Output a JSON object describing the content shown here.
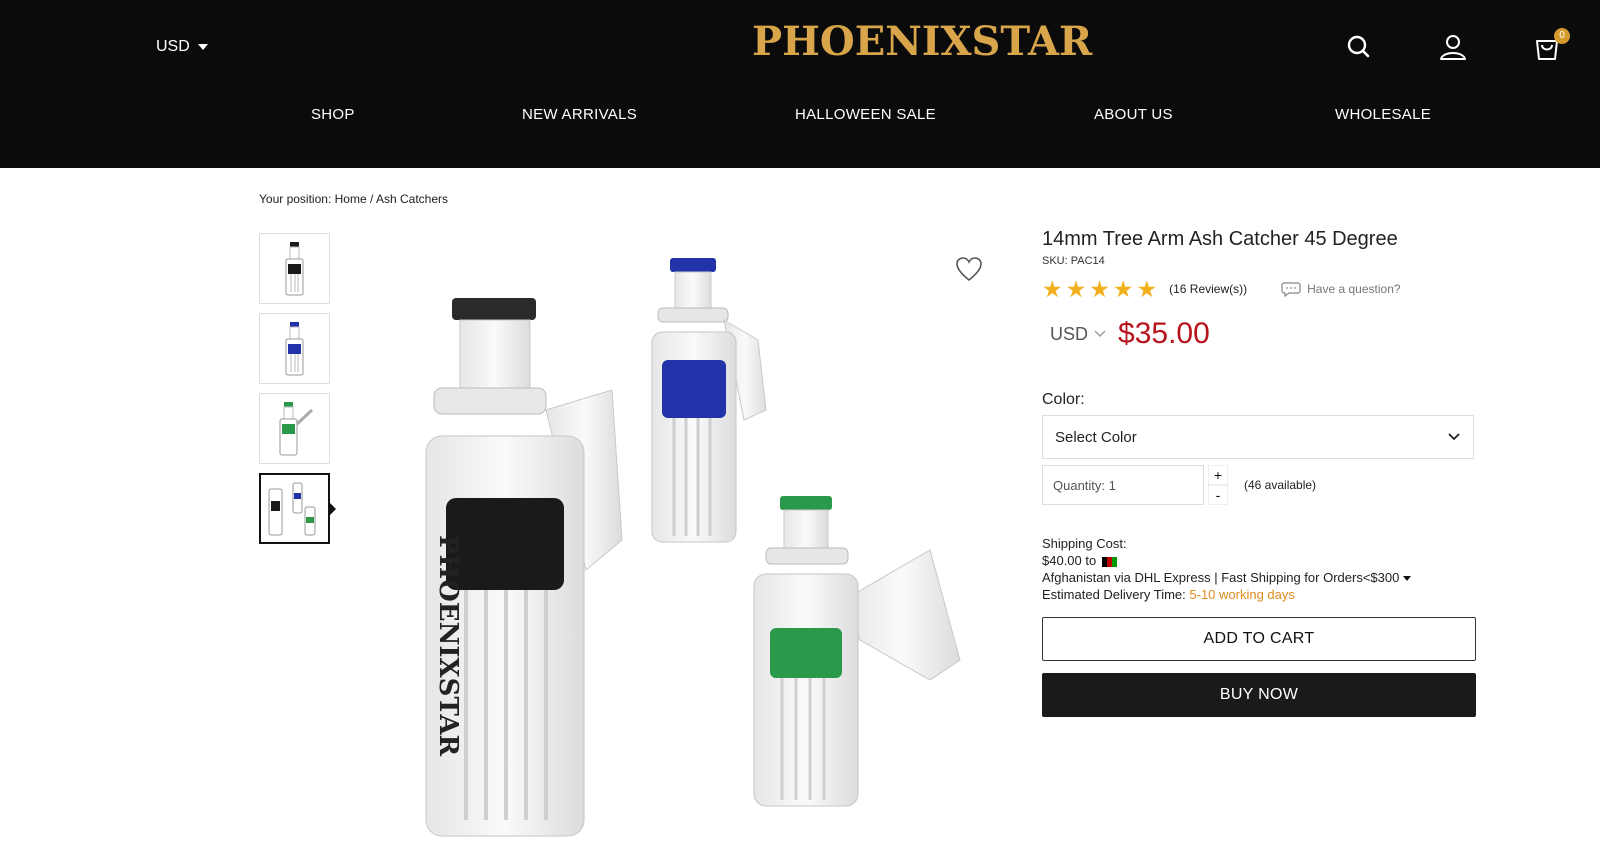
{
  "header": {
    "currency": "USD",
    "logo": "PHOENIXSTAR",
    "cart_count": "0",
    "icons": [
      "search-icon",
      "user-icon",
      "cart-icon"
    ]
  },
  "nav": [
    "SHOP",
    "NEW ARRIVALS",
    "HALLOWEEN SALE",
    "ABOUT US",
    "WHOLESALE"
  ],
  "breadcrumb": {
    "prefix": "Your position:",
    "home": "Home",
    "separator": "/",
    "current": "Ash Catchers"
  },
  "product": {
    "title": "14mm Tree Arm Ash Catcher 45 Degree",
    "sku": "SKU: PAC14",
    "rating_stars": 5,
    "reviews": "(16 Review(s))",
    "question": "Have a question?",
    "currency": "USD",
    "price": "$35.00",
    "color_label": "Color:",
    "color_select": "Select Color",
    "quantity": "Quantity: 1",
    "qty_plus": "+",
    "qty_minus": "-",
    "available": "(46 available)",
    "shipping_cost_label": "Shipping Cost:",
    "shipping_cost": "$40.00 to",
    "shipping_method": "Afghanistan via DHL Express | Fast Shipping for Orders<$300",
    "delivery_label": "Estimated Delivery Time:",
    "delivery_time": "5-10 working days",
    "add_to_cart": "ADD TO CART",
    "buy_now": "BUY NOW"
  },
  "colors": {
    "header_bg": "#0b0b0b",
    "logo_gold": "#d9a54a",
    "price_red": "#b7141b",
    "star_gold": "#f2b01e",
    "delivery_orange": "#e08b1e",
    "glass_blue": "#2233aa",
    "glass_green": "#2a9a4a",
    "glass_black": "#1a1a1a"
  },
  "thumbnails": [
    {
      "variant": "black"
    },
    {
      "variant": "blue"
    },
    {
      "variant": "green"
    },
    {
      "variant": "all"
    }
  ]
}
